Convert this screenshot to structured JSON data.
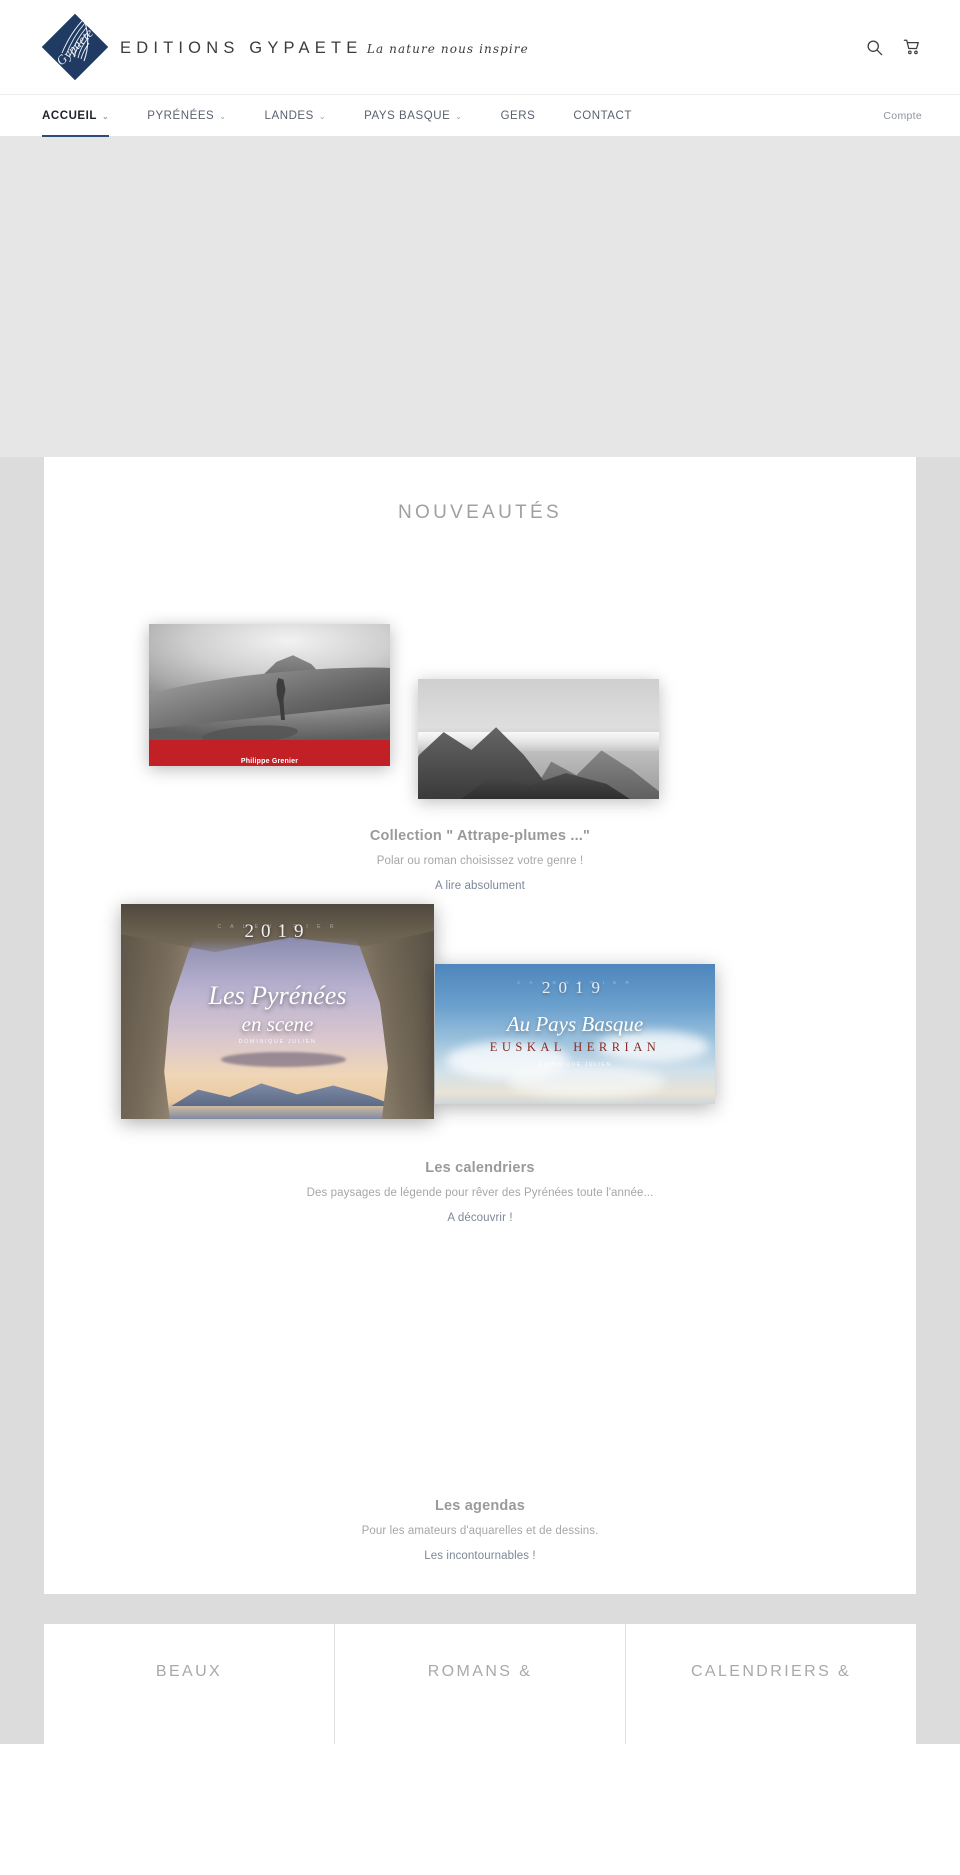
{
  "header": {
    "logo": {
      "mark_word": "Gypaete",
      "title": "EDITIONS GYPAETE",
      "tagline": "La nature nous inspire"
    },
    "actions": [
      {
        "name": "search-icon",
        "label": "Recherche"
      },
      {
        "name": "cart-icon",
        "label": "Panier"
      }
    ]
  },
  "nav": {
    "items": [
      {
        "label": "ACCUEIL",
        "has_caret": true,
        "active": true
      },
      {
        "label": "PYRÉNÉES",
        "has_caret": true,
        "active": false
      },
      {
        "label": "LANDES",
        "has_caret": true,
        "active": false
      },
      {
        "label": "PAYS BASQUE",
        "has_caret": true,
        "active": false
      },
      {
        "label": "GERS",
        "has_caret": false,
        "active": false
      },
      {
        "label": "CONTACT",
        "has_caret": false,
        "active": false
      }
    ],
    "account_label": "Compte",
    "caret_glyph": "⌄",
    "accent_color": "#2f4c79"
  },
  "main": {
    "section_title": "NOUVEAUTÉS",
    "promos": [
      {
        "title": "Collection \" Attrape-plumes ...\"",
        "subtitle": "Polar ou roman choisissez votre genre !",
        "link": "A lire absolument",
        "images": [
          {
            "name": "book-cover-mountaineer",
            "band_text": "Philippe Grenier",
            "band_color": "#c02026"
          },
          {
            "name": "book-cover-misty-peaks"
          }
        ]
      },
      {
        "title": "Les calendriers",
        "subtitle": "Des paysages de légende pour rêver des Pyrénées toute l'année...",
        "link": "A découvrir !",
        "images": [
          {
            "name": "calendar-pyrenees-en-scene",
            "kicker": "C A L E N D R I E R",
            "year": "2019",
            "line1": "Les Pyrénées",
            "line2": "en scene",
            "author": "DOMINIQUE JULIEN"
          },
          {
            "name": "calendar-au-pays-basque",
            "kicker": "C A L E N D R I E R",
            "year": "2019",
            "line1": "Au Pays Basque",
            "line2": "EUSKAL HERRIAN",
            "author": "DOMINIQUE JULIEN"
          }
        ]
      },
      {
        "title": "Les agendas",
        "subtitle": "Pour les amateurs d'aquarelles et de dessins.",
        "link": "Les incontournables !",
        "images": []
      }
    ],
    "categories": [
      {
        "line1": "BEAUX",
        "line2": ""
      },
      {
        "line1": "ROMANS &",
        "line2": ""
      },
      {
        "line1": "CALENDRIERS &",
        "line2": ""
      }
    ]
  }
}
